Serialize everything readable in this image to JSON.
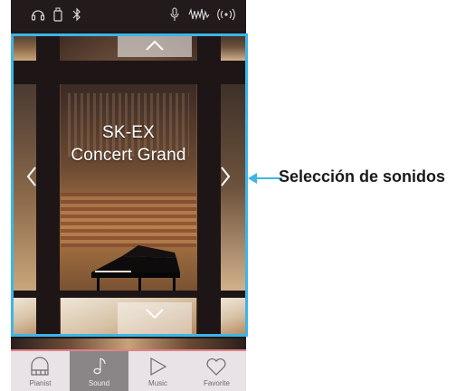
{
  "status_bar": {
    "icons": [
      "headphones-icon",
      "usb-icon",
      "bluetooth-icon",
      "mic-icon",
      "waveform-icon",
      "wireless-icon"
    ]
  },
  "carousel": {
    "sound_name_line1": "SK-EX",
    "sound_name_line2": "Concert Grand"
  },
  "tabs": [
    {
      "label": "Pianist",
      "icon": "piano-icon",
      "active": false
    },
    {
      "label": "Sound",
      "icon": "music-note-icon",
      "active": true
    },
    {
      "label": "Music",
      "icon": "play-icon",
      "active": false
    },
    {
      "label": "Favorite",
      "icon": "heart-icon",
      "active": false
    }
  ],
  "callout": {
    "text": "Selección de sonidos",
    "color": "#3db5e6"
  }
}
